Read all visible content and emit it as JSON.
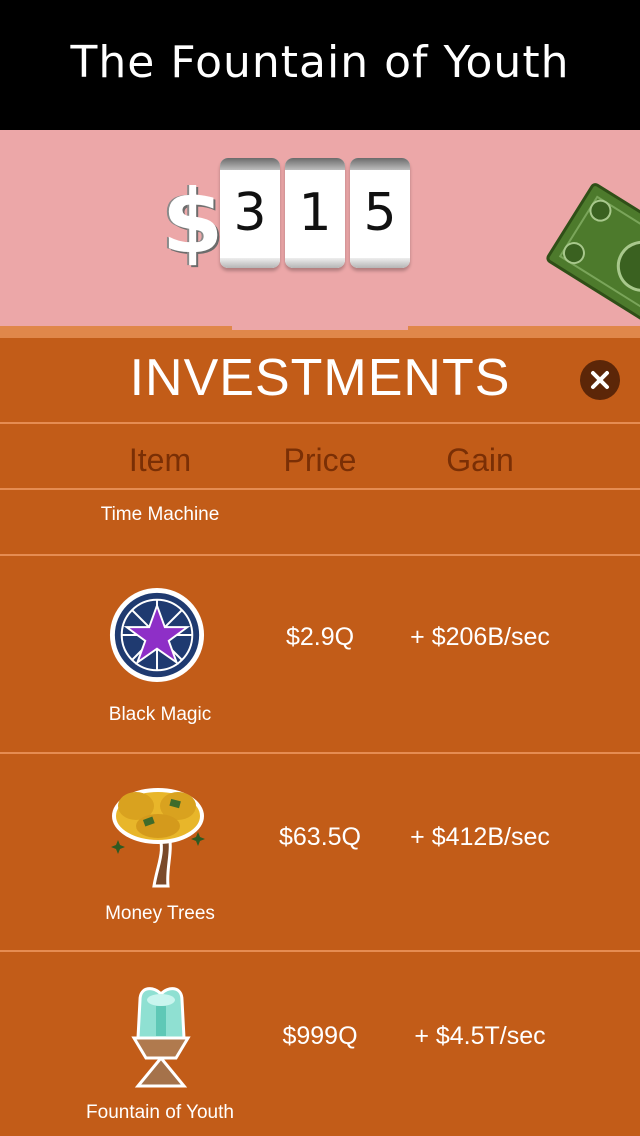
{
  "header": {
    "title": "The Fountain of Youth"
  },
  "money": {
    "currency_symbol": "$",
    "digits": [
      "3",
      "1",
      "5"
    ],
    "icon": "dollar-bill-icon"
  },
  "investments": {
    "heading": "INVESTMENTS",
    "close_icon": "close-icon",
    "columns": {
      "item": "Item",
      "price": "Price",
      "gain": "Gain"
    },
    "rows": [
      {
        "name": "Time Machine",
        "price": "",
        "gain": ""
      },
      {
        "name": "Black Magic",
        "price": "$2.9Q",
        "gain": "+ $206B/sec",
        "icon": "pentagram-star-icon"
      },
      {
        "name": "Money Trees",
        "price": "$63.5Q",
        "gain": "+ $412B/sec",
        "icon": "money-tree-icon"
      },
      {
        "name": "Fountain of Youth",
        "price": "$999Q",
        "gain": "+ $4.5T/sec",
        "icon": "fountain-icon"
      }
    ]
  },
  "colors": {
    "header_bg": "#000000",
    "money_area_bg": "#eca7a8",
    "panel_bg": "#c25c18",
    "column_header_text": "#7a2f05"
  }
}
